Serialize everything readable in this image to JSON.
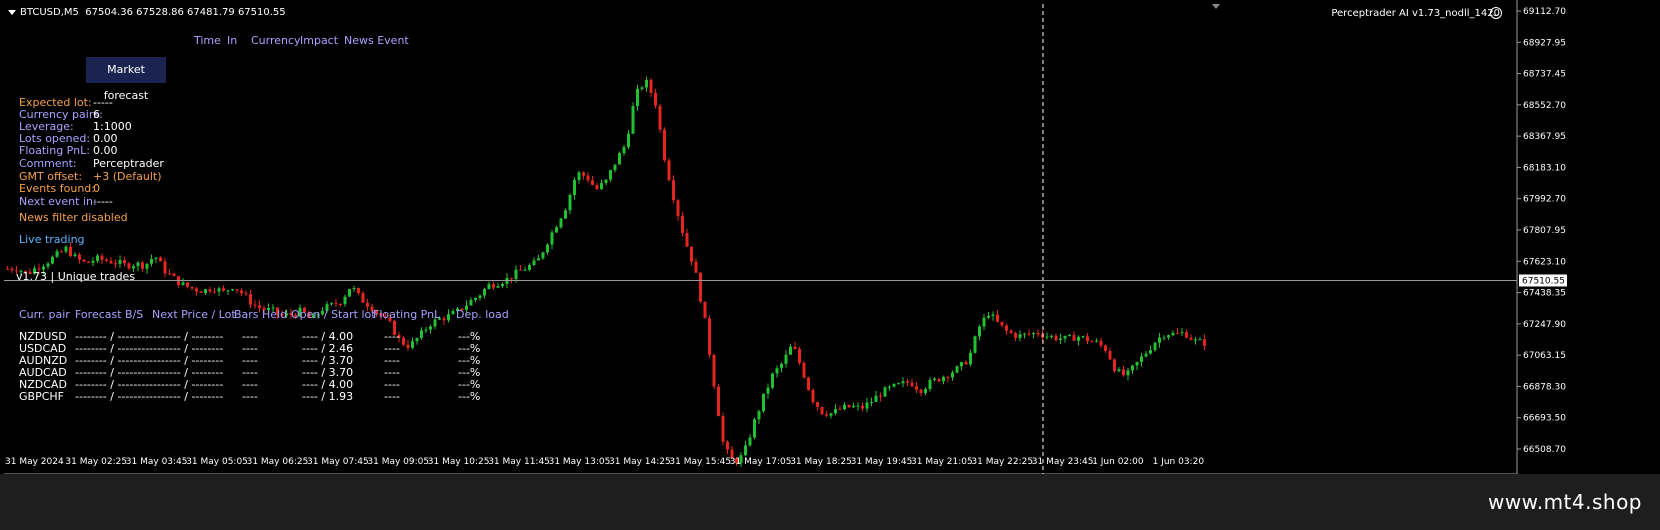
{
  "header": {
    "symbol": "BTCUSD,M5",
    "ohlc": "67504.36 67528.86 67481.79 67510.55",
    "ea_name": "Perceptrader AI v1.73_nodll_1420"
  },
  "news_header": [
    "Time",
    "In",
    "Currency",
    "Impact",
    "News Event"
  ],
  "market_forecast_button": "Market forecast",
  "info": {
    "labels": [
      "Expected lot:",
      "Currency pairs:",
      "Leverage:",
      "Lots opened:",
      "Floating PnL:",
      "Comment:",
      "GMT offset:",
      "Events found:",
      "Next event in:"
    ],
    "values": [
      "-----",
      "6",
      "1:1000",
      "0.00",
      "0.00",
      "Perceptrader",
      "+3 (Default)",
      "0",
      "-----"
    ],
    "news_filter": "News filter disabled",
    "live_trading": "Live trading"
  },
  "version_line": "v1.73 | Unique trades",
  "table": {
    "headers": [
      "Curr. pair",
      "Forecast B/S",
      "Next Price / Lot",
      "Bars Held",
      "Open / Start lot",
      "Floating PnL",
      "Dep. load"
    ],
    "rows": [
      [
        "NZDUSD",
        "-------- / --------",
        "-------- / --------",
        "----",
        "---- / 4.00",
        "----",
        "---%"
      ],
      [
        "USDCAD",
        "-------- / --------",
        "-------- / --------",
        "----",
        "---- / 2.46",
        "----",
        "---%"
      ],
      [
        "AUDNZD",
        "-------- / --------",
        "-------- / --------",
        "----",
        "---- / 3.70",
        "----",
        "---%"
      ],
      [
        "AUDCAD",
        "-------- / --------",
        "-------- / --------",
        "----",
        "---- / 3.70",
        "----",
        "---%"
      ],
      [
        "NZDCAD",
        "-------- / --------",
        "-------- / --------",
        "----",
        "---- / 4.00",
        "----",
        "---%"
      ],
      [
        "GBPCHF",
        "-------- / --------",
        "-------- / --------",
        "----",
        "---- / 1.93",
        "----",
        "---%"
      ]
    ]
  },
  "price_axis": {
    "labels": [
      "69112.70",
      "68927.95",
      "68737.45",
      "68552.70",
      "68367.95",
      "68183.10",
      "67992.70",
      "67807.95",
      "67623.10",
      "67438.35",
      "67247.90",
      "67063.15",
      "66878.30",
      "66693.50",
      "66508.70"
    ],
    "current_price": "67510.55"
  },
  "time_axis": {
    "labels": [
      "31 May 2024",
      "31 May 02:25",
      "31 May 03:45",
      "31 May 05:05",
      "31 May 06:25",
      "31 May 07:45",
      "31 May 09:05",
      "31 May 10:25",
      "31 May 11:45",
      "31 May 13:05",
      "31 May 14:25",
      "31 May 15:45",
      "31 May 17:05",
      "31 May 18:25",
      "31 May 19:45",
      "31 May 21:05",
      "31 May 22:25",
      "31 May 23:45",
      "1 Jun 02:00",
      "1 Jun 03:20"
    ]
  },
  "price_path": [
    67580,
    67585,
    67550,
    67590,
    67620,
    67660,
    67700,
    67640,
    67610,
    67640,
    67630,
    67620,
    67600,
    67610,
    67600,
    67660,
    67570,
    67520,
    67480,
    67460,
    67450,
    67470,
    67440,
    67480,
    67430,
    67370,
    67340,
    67330,
    67300,
    67310,
    67330,
    67270,
    67340,
    67360,
    67390,
    67480,
    67400,
    67360,
    67300,
    67250,
    67150,
    67120,
    67180,
    67250,
    67280,
    67300,
    67330,
    67380,
    67420,
    67480,
    67500,
    67520,
    67560,
    67590,
    67620,
    67740,
    67850,
    67960,
    68150,
    68130,
    68050,
    68100,
    68220,
    68320,
    68610,
    68700,
    68580,
    68230,
    67980,
    67760,
    67590,
    67300,
    66900,
    66520,
    66430,
    66470,
    66650,
    66810,
    66950,
    67020,
    67130,
    66980,
    66810,
    66730,
    66720,
    66750,
    66760,
    66750,
    66790,
    66840,
    66870,
    66890,
    66910,
    66860,
    66900,
    66930,
    66960,
    66990,
    67050,
    67230,
    67320,
    67250,
    67200,
    67180,
    67190,
    67200,
    67180,
    67170,
    67160,
    67180,
    67160,
    67140,
    67100,
    66970,
    66940,
    67010,
    67080,
    67150,
    67200,
    67190,
    67200,
    67150,
    67140
  ],
  "colors": {
    "bull": "#22c132",
    "bear": "#e5251e",
    "orange": "#f5a04a",
    "lavender": "#a9a2ff",
    "blue": "#5ab4ff"
  },
  "watermark": "www.mt4.shop"
}
